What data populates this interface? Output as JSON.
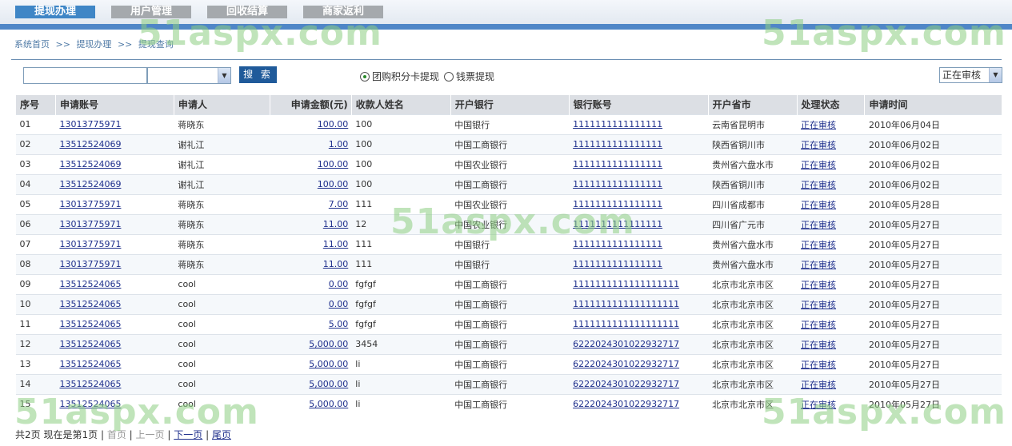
{
  "nav": {
    "tabs": [
      {
        "label": "提现办理",
        "active": true
      },
      {
        "label": "用户管理",
        "active": false
      },
      {
        "label": "回收结算",
        "active": false
      },
      {
        "label": "商家返利",
        "active": false
      }
    ]
  },
  "breadcrumb": [
    "系统首页",
    ">>",
    "提现办理",
    ">>",
    "提现查询"
  ],
  "search": {
    "input_value": "",
    "select_value": "",
    "button_label": "搜 索",
    "radio_options": [
      {
        "label": "团购积分卡提现",
        "checked": true
      },
      {
        "label": "钱票提现",
        "checked": false
      }
    ],
    "status_select": "正在审核"
  },
  "table": {
    "headers": [
      "序号",
      "申请账号",
      "申请人",
      "申请金额(元)",
      "收款人姓名",
      "开户银行",
      "银行账号",
      "开户省市",
      "处理状态",
      "申请时间"
    ],
    "rows": [
      [
        "01",
        "13013775971",
        "蒋晓东",
        "100.00",
        "100",
        "中国银行",
        "1111111111111111",
        "云南省昆明市",
        "正在审核",
        "2010年06月04日"
      ],
      [
        "02",
        "13512524069",
        "谢礼江",
        "1.00",
        "100",
        "中国工商银行",
        "1111111111111111",
        "陕西省铜川市",
        "正在审核",
        "2010年06月02日"
      ],
      [
        "03",
        "13512524069",
        "谢礼江",
        "100.00",
        "100",
        "中国农业银行",
        "1111111111111111",
        "贵州省六盘水市",
        "正在审核",
        "2010年06月02日"
      ],
      [
        "04",
        "13512524069",
        "谢礼江",
        "100.00",
        "100",
        "中国工商银行",
        "1111111111111111",
        "陕西省铜川市",
        "正在审核",
        "2010年06月02日"
      ],
      [
        "05",
        "13013775971",
        "蒋晓东",
        "7.00",
        "111",
        "中国农业银行",
        "1111111111111111",
        "四川省成都市",
        "正在审核",
        "2010年05月28日"
      ],
      [
        "06",
        "13013775971",
        "蒋晓东",
        "11.00",
        "12",
        "中国农业银行",
        "1111111111111111",
        "四川省广元市",
        "正在审核",
        "2010年05月27日"
      ],
      [
        "07",
        "13013775971",
        "蒋晓东",
        "11.00",
        "111",
        "中国银行",
        "1111111111111111",
        "贵州省六盘水市",
        "正在审核",
        "2010年05月27日"
      ],
      [
        "08",
        "13013775971",
        "蒋晓东",
        "11.00",
        "111",
        "中国银行",
        "1111111111111111",
        "贵州省六盘水市",
        "正在审核",
        "2010年05月27日"
      ],
      [
        "09",
        "13512524065",
        "cool",
        "0.00",
        "fgfgf",
        "中国工商银行",
        "1111111111111111111",
        "北京市北京市区",
        "正在审核",
        "2010年05月27日"
      ],
      [
        "10",
        "13512524065",
        "cool",
        "0.00",
        "fgfgf",
        "中国工商银行",
        "1111111111111111111",
        "北京市北京市区",
        "正在审核",
        "2010年05月27日"
      ],
      [
        "11",
        "13512524065",
        "cool",
        "5.00",
        "fgfgf",
        "中国工商银行",
        "1111111111111111111",
        "北京市北京市区",
        "正在审核",
        "2010年05月27日"
      ],
      [
        "12",
        "13512524065",
        "cool",
        "5,000.00",
        "3454",
        "中国工商银行",
        "6222024301022932717",
        "北京市北京市区",
        "正在审核",
        "2010年05月27日"
      ],
      [
        "13",
        "13512524065",
        "cool",
        "5,000.00",
        "li",
        "中国工商银行",
        "6222024301022932717",
        "北京市北京市区",
        "正在审核",
        "2010年05月27日"
      ],
      [
        "14",
        "13512524065",
        "cool",
        "5,000.00",
        "li",
        "中国工商银行",
        "6222024301022932717",
        "北京市北京市区",
        "正在审核",
        "2010年05月27日"
      ],
      [
        "15",
        "13512524065",
        "cool",
        "5,000.00",
        "li",
        "中国工商银行",
        "6222024301022932717",
        "北京市北京市区",
        "正在审核",
        "2010年05月27日"
      ]
    ]
  },
  "pager": {
    "total": "共2页",
    "current": "现在是第1页",
    "first": "首页",
    "prev": "上一页",
    "next": "下一页",
    "last": "尾页",
    "sep": "|"
  },
  "watermark": "51aspx.com"
}
